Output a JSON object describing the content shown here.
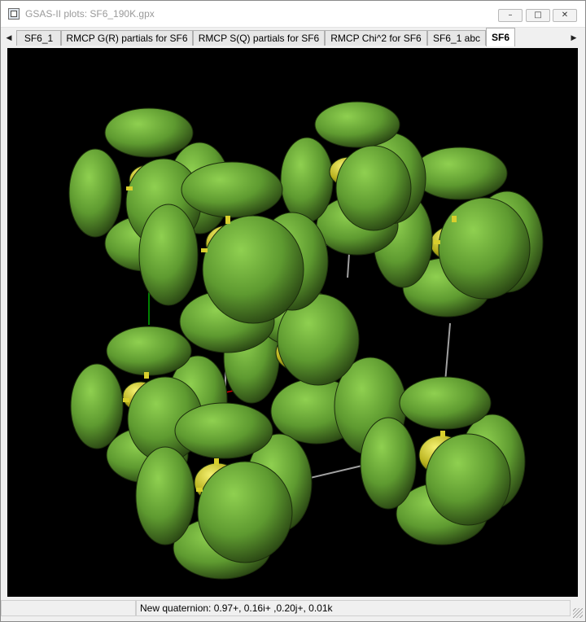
{
  "window": {
    "title": "GSAS-II plots: SF6_190K.gpx",
    "app_icon": "window-app-icon",
    "controls": {
      "minimize": "–",
      "maximize": "□",
      "close": "✕"
    }
  },
  "tabs": {
    "scroll_left": "◀",
    "scroll_right": "▶",
    "items": [
      {
        "label": "SF6_1"
      },
      {
        "label": "RMCP G(R) partials for SF6"
      },
      {
        "label": "RMCP S(Q) partials for SF6"
      },
      {
        "label": "RMCP Chi^2 for SF6"
      },
      {
        "label": "SF6_1 abc"
      },
      {
        "label": "SF6",
        "active": true
      }
    ]
  },
  "plot": {
    "background": "#000000",
    "atom_colors": {
      "fluorine": "#6aa23a",
      "sulfur": "#c8c62a",
      "bond": "#d8cf2c"
    },
    "cell_edge_color": "#a0a0a0",
    "axis_colors": {
      "a": "#cc0000",
      "b": "#00aa00"
    }
  },
  "status": {
    "left": "",
    "message": "New quaternion: 0.97+, 0.16i+ ,0.20j+, 0.01k"
  }
}
